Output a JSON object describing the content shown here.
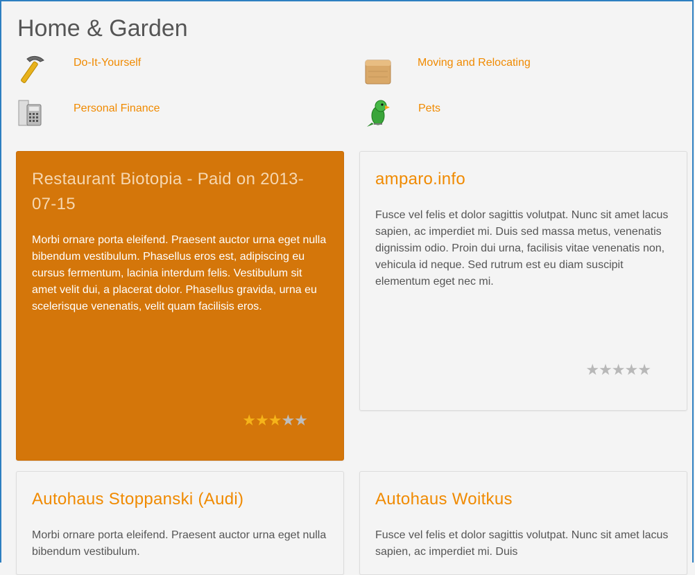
{
  "page": {
    "title": "Home & Garden"
  },
  "categories": [
    {
      "label": "Do-It-Yourself",
      "icon": "hammer-icon"
    },
    {
      "label": "Moving and Relocating",
      "icon": "box-icon"
    },
    {
      "label": "Personal Finance",
      "icon": "calculator-icon"
    },
    {
      "label": "Pets",
      "icon": "parrot-icon"
    }
  ],
  "listings": [
    {
      "title": "Restaurant Biotopia - Paid on 2013-07-15",
      "description": "Morbi ornare porta eleifend. Praesent auctor urna eget nulla bibendum vestibulum. Phasellus eros est, adipiscing eu cursus fermentum, lacinia interdum felis. Vestibulum sit amet velit dui, a placerat dolor. Phasellus gravida, urna eu scelerisque venenatis, velit quam facilisis eros.",
      "rating": 3,
      "featured": true
    },
    {
      "title": "amparo.info",
      "description": "Fusce vel felis et dolor sagittis volutpat. Nunc sit amet lacus sapien, ac imperdiet mi. Duis sed massa metus, venenatis dignissim odio. Proin dui urna, facilisis vitae venenatis non, vehicula id neque. Sed rutrum est eu diam suscipit elementum eget nec mi.",
      "rating": 0,
      "featured": false
    },
    {
      "title": "Autohaus Stoppanski (Audi)",
      "description": "Morbi ornare porta eleifend. Praesent auctor urna eget nulla bibendum vestibulum.",
      "featured": false
    },
    {
      "title": "Autohaus Woitkus",
      "description": "Fusce vel felis et dolor sagittis volutpat. Nunc sit amet lacus sapien, ac imperdiet mi. Duis",
      "featured": false
    }
  ],
  "colors": {
    "accent": "#f08a00",
    "featured_bg": "#d4760a",
    "frame": "#2d7fc1"
  }
}
